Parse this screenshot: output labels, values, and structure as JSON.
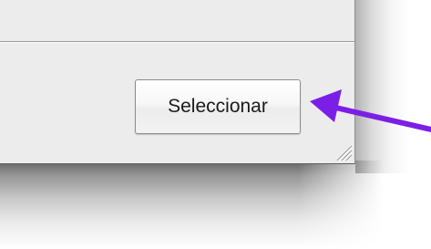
{
  "dialog": {
    "buttons": {
      "select_label": "Seleccionar"
    },
    "resize_grip_icon": "resize-grip-icon"
  },
  "annotation": {
    "arrow_icon": "arrow-pointer-icon",
    "arrow_color": "#7b1fe6"
  },
  "colors": {
    "dialog_background": "#ececec",
    "button_border": "#8c8c8c",
    "button_text": "#1a1a1a"
  }
}
